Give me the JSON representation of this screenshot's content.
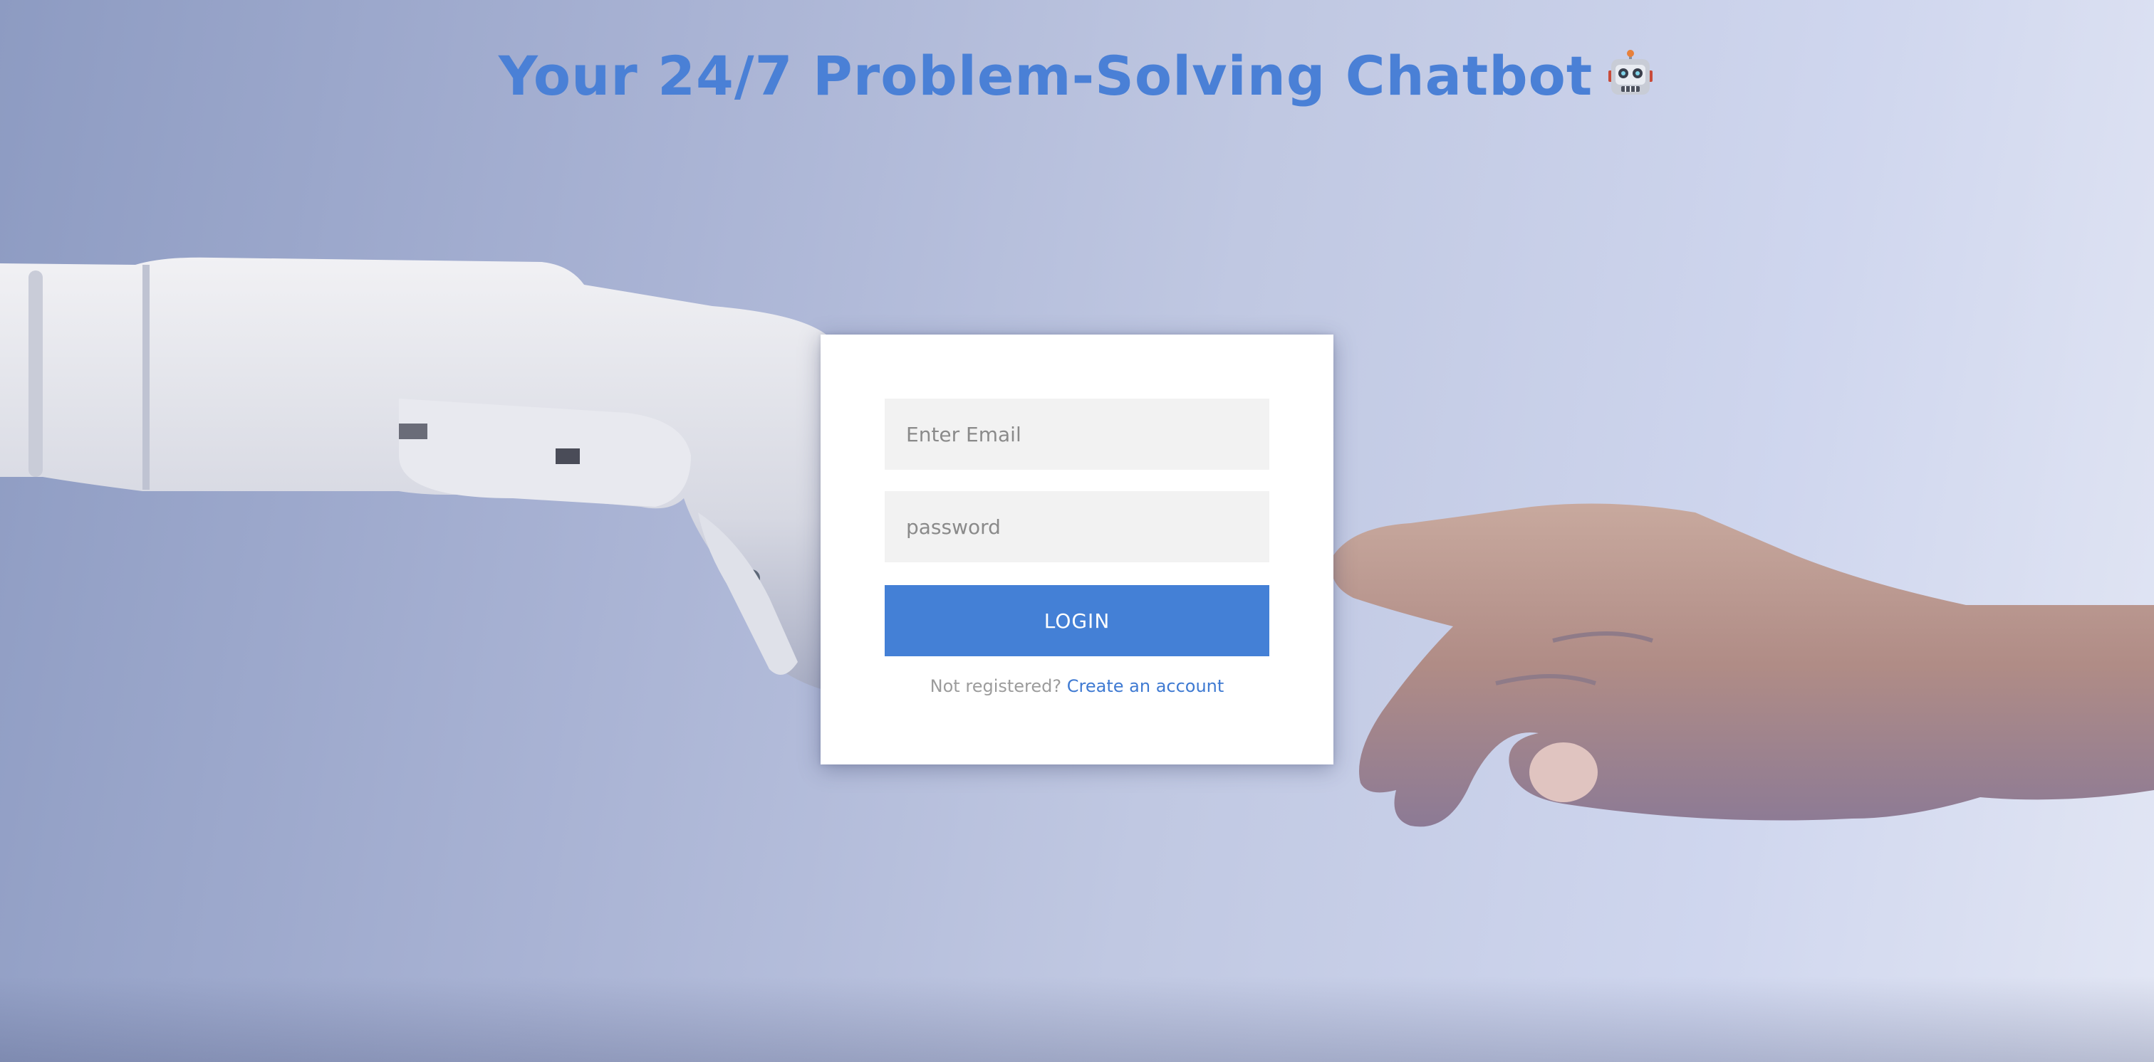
{
  "header": {
    "title": "Your 24/7 Problem-Solving Chatbot"
  },
  "icons": {
    "title_emoji": "robot-face-icon"
  },
  "background": {
    "image": "robot-hand-and-human-hand-photo"
  },
  "login_form": {
    "email_placeholder": "Enter Email",
    "email_value": "",
    "password_placeholder": "password",
    "password_value": "",
    "login_label": "LOGIN",
    "register_prompt": "Not registered?",
    "register_link": "Create an account"
  },
  "colors": {
    "accent": "#4480d6",
    "title": "#4a80d6",
    "link": "#3f7ad2",
    "input_bg": "#f2f2f2"
  }
}
